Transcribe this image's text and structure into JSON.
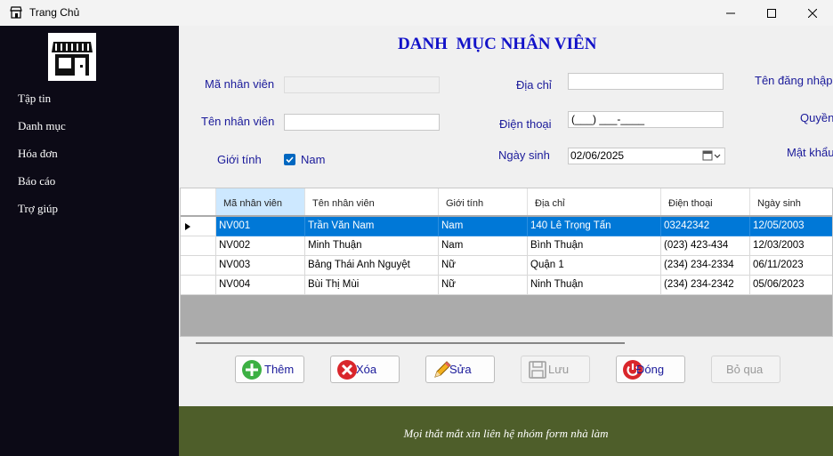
{
  "window": {
    "title": "Trang Chủ",
    "icon": "store-icon"
  },
  "sidebar": {
    "menu": [
      {
        "label": "Tập tin"
      },
      {
        "label": "Danh mục"
      },
      {
        "label": "Hóa đơn"
      },
      {
        "label": "Báo cáo"
      },
      {
        "label": "Trợ giúp"
      }
    ]
  },
  "form": {
    "heading": "DANH  MỤC NHÂN VIÊN",
    "ma_nv_label": "Mã nhân viên",
    "ma_nv_value": "",
    "ten_nv_label": "Tên nhân viên",
    "ten_nv_value": "",
    "gioi_tinh_label": "Giới tính",
    "gioi_tinh_option": "Nam",
    "gioi_tinh_checked": true,
    "dia_chi_label": "Địa chỉ",
    "dia_chi_value": "",
    "dien_thoai_label": "Điện thoại",
    "dien_thoai_value": "(___) ___-____",
    "ngay_sinh_label": "Ngày sinh",
    "ngay_sinh_value": "02/06/2025",
    "ten_dang_nhap_label": "Tên đăng nhập",
    "quyen_label": "Quyền",
    "mat_khau_label": "Mật khẩu"
  },
  "grid": {
    "columns": [
      "Mã nhân viên",
      "Tên nhân viên",
      "Giới tính",
      "Địa chỉ",
      "Điện thoại",
      "Ngày sinh"
    ],
    "rows": [
      [
        "NV001",
        "Trần Văn Nam",
        "Nam",
        "140 Lê Trọng Tấn",
        "03242342",
        "12/05/2003"
      ],
      [
        "NV002",
        "Minh Thuận",
        "Nam",
        "Bình Thuận",
        "(023) 423-434",
        "12/03/2003"
      ],
      [
        "NV003",
        "Bảng Thái Anh Nguyệt",
        "Nữ",
        "Quận 1",
        "(234) 234-2334",
        "06/11/2023"
      ],
      [
        "NV004",
        "Bùi Thị Mùi",
        "Nữ",
        "Ninh Thuận",
        "(234) 234-2342",
        "05/06/2023"
      ]
    ],
    "selected_row": 0
  },
  "buttons": {
    "them": "Thêm",
    "xoa": "Xóa",
    "sua": "Sửa",
    "luu": "Lưu",
    "dong": "Đóng",
    "bo_qua": "Bỏ qua"
  },
  "footer": {
    "text": "Mọi thắt mắt xin liên hệ nhóm form nhà làm"
  },
  "colors": {
    "sidebar_bg": "#0c0a16",
    "footer_bg": "#4e5e2a",
    "heading": "#1212c8",
    "selection": "#0078d7"
  }
}
